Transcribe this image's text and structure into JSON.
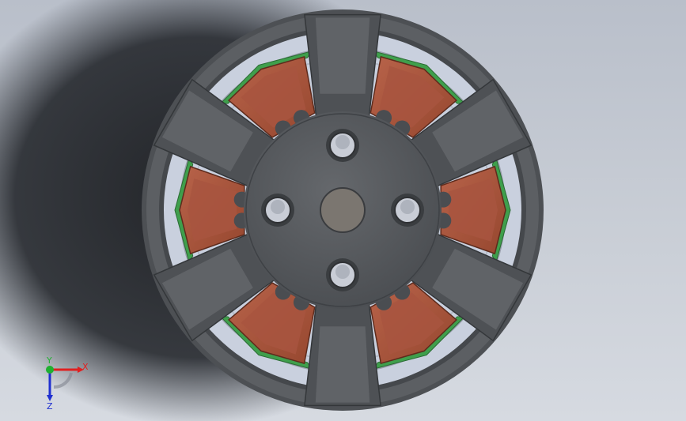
{
  "viewport": {
    "background_top": "#b9bfca",
    "background_bottom": "#d6dae1",
    "shadow_color": "#1e2126"
  },
  "model": {
    "rim_color": "#5a5d61",
    "spoke_color": "#4e5155",
    "hub_color": "#56595d",
    "cavity_color": "#cfd5e2",
    "coil_color": "#a8553f",
    "insulation_color": "#3f9f4c",
    "spoke_count": 6,
    "bolt_hole_count": 4
  },
  "triad": {
    "x_label": "X",
    "y_label": "Y",
    "z_label": "Z",
    "x_color": "#e02020",
    "y_color": "#20b030",
    "z_color": "#2030d0"
  }
}
